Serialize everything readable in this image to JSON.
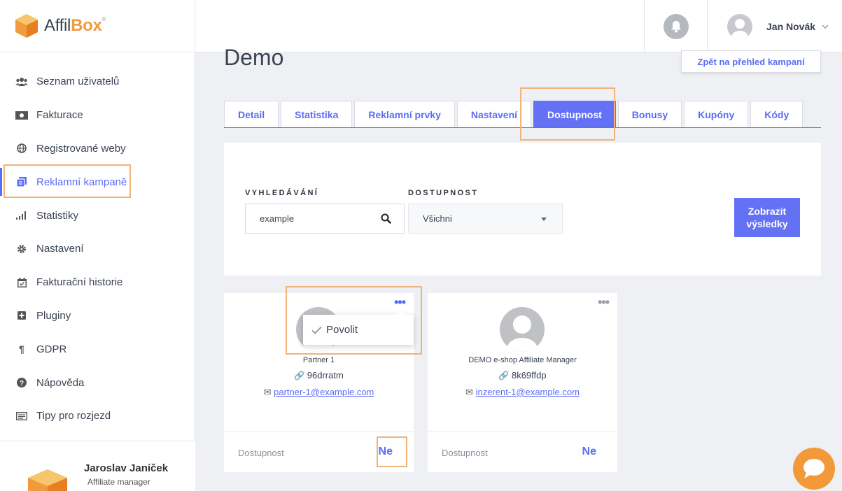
{
  "logo": {
    "prefix": "Affil",
    "bold": "Box",
    "mark": "®"
  },
  "sidebar": {
    "items": [
      {
        "label": "Seznam uživatelů",
        "icon": "users-icon"
      },
      {
        "label": "Fakturace",
        "icon": "money-icon"
      },
      {
        "label": "Registrované weby",
        "icon": "globe-icon"
      },
      {
        "label": "Reklamní kampaně",
        "icon": "campaign-icon",
        "active": true
      },
      {
        "label": "Statistiky",
        "icon": "bar-chart-icon"
      },
      {
        "label": "Nastavení",
        "icon": "gear-icon"
      },
      {
        "label": "Fakturační historie",
        "icon": "calendar-icon"
      },
      {
        "label": "Pluginy",
        "icon": "plus-square-icon"
      },
      {
        "label": "GDPR",
        "icon": "paragraph-icon"
      },
      {
        "label": "Nápověda",
        "icon": "question-icon"
      },
      {
        "label": "Tipy pro rozjezd",
        "icon": "list-icon"
      }
    ],
    "user": {
      "name": "Jaroslav Janíček",
      "role": "Affiliate manager"
    }
  },
  "header": {
    "user_name": "Jan Novák"
  },
  "main": {
    "title": "Demo",
    "back_button": "Zpět na přehled kampaní",
    "tabs": [
      {
        "label": "Detail"
      },
      {
        "label": "Statistika"
      },
      {
        "label": "Reklamní prvky"
      },
      {
        "label": "Nastavení"
      },
      {
        "label": "Dostupnost",
        "active": true
      },
      {
        "label": "Bonusy"
      },
      {
        "label": "Kupóny"
      },
      {
        "label": "Kódy"
      }
    ],
    "filter": {
      "search_label": "VYHLEDÁVÁNÍ",
      "search_value": "example",
      "availability_label": "DOSTUPNOST",
      "availability_value": "Všichni",
      "submit_label": "Zobrazit výsledky"
    },
    "cards": [
      {
        "name": "Partner 1",
        "code": "96drratm",
        "email": "partner-1@example.com",
        "foot_label": "Dostupnost",
        "foot_value": "Ne"
      },
      {
        "name": "DEMO e-shop Affiliate Manager",
        "code": "8k69ffdp",
        "email": "inzerent-1@example.com",
        "foot_label": "Dostupnost",
        "foot_value": "Ne"
      }
    ],
    "menu": {
      "allow_label": "Povolit"
    }
  },
  "colors": {
    "accent": "#6571f5",
    "brand_orange": "#f19a3e",
    "highlight": "#f0b37a"
  }
}
